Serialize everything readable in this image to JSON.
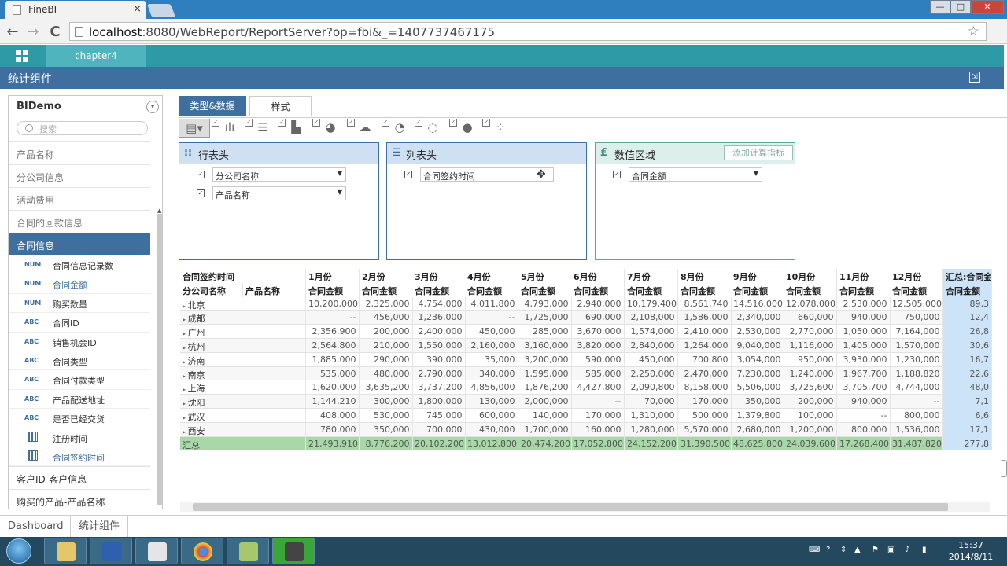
{
  "browser": {
    "tab_title": "FineBI",
    "tab_close": "×",
    "url_host": "localhost",
    "url_rest": ":8080/WebReport/ReportServer?op=fbi&_=1407737467175",
    "back": "←",
    "forward": "→",
    "reload": "C",
    "star": "☆",
    "menu": "≡",
    "win_min": "—",
    "win_max": "□",
    "win_close": "✕"
  },
  "app": {
    "chapter_tab": "chapter4",
    "header_title": "统计组件"
  },
  "left_panel": {
    "package_name": "BIDemo",
    "search_placeholder": "搜索",
    "groups_top": [
      "产品名称",
      "分公司信息",
      "活动费用",
      "合同的回款信息"
    ],
    "selected_group": "合同信息",
    "fields": [
      {
        "type": "NUM",
        "label": "合同信息记录数",
        "selected": false
      },
      {
        "type": "NUM",
        "label": "合同金额",
        "selected": true
      },
      {
        "type": "NUM",
        "label": "购买数量",
        "selected": false
      },
      {
        "type": "ABC",
        "label": "合同ID",
        "selected": false
      },
      {
        "type": "ABC",
        "label": "销售机会ID",
        "selected": false
      },
      {
        "type": "ABC",
        "label": "合同类型",
        "selected": false
      },
      {
        "type": "ABC",
        "label": "合同付款类型",
        "selected": false
      },
      {
        "type": "ABC",
        "label": "产品配送地址",
        "selected": false
      },
      {
        "type": "ABC",
        "label": "是否已经交货",
        "selected": false
      },
      {
        "type": "DATE",
        "label": "注册时间",
        "selected": false
      },
      {
        "type": "DATE",
        "label": "合同签约时间",
        "selected": true
      }
    ],
    "groups_bottom": [
      "客户ID-客户信息",
      "购买的产品-产品名称"
    ]
  },
  "tabs": {
    "type_data": "类型&数据",
    "style": "样式"
  },
  "regions": {
    "row_header": {
      "title": "行表头",
      "items": [
        "分公司名称",
        "产品名称"
      ]
    },
    "column_header": {
      "title": "列表头",
      "items": [
        "合同签约时间"
      ]
    },
    "value_area": {
      "title": "数值区域",
      "add_button": "添加计算指标",
      "items": [
        "合同金额"
      ]
    }
  },
  "table": {
    "corner_top": "合同签约时间",
    "corner_left1": "分公司名称",
    "corner_left2": "产品名称",
    "months": [
      "1月份",
      "2月份",
      "3月份",
      "4月份",
      "5月份",
      "6月份",
      "7月份",
      "8月份",
      "9月份",
      "10月份",
      "11月份",
      "12月份"
    ],
    "total_header": "汇总:合同金",
    "measure": "合同金额",
    "rows": [
      {
        "city": "北京",
        "values": [
          "10,200,000",
          "2,325,000",
          "4,754,000",
          "4,011,800",
          "4,793,000",
          "2,940,000",
          "10,179,400",
          "8,561,740",
          "14,516,000",
          "12,078,000",
          "2,530,000",
          "12,505,000"
        ],
        "total": "89,3"
      },
      {
        "city": "成都",
        "values": [
          "--",
          "456,000",
          "1,236,000",
          "--",
          "1,725,000",
          "690,000",
          "2,108,000",
          "1,586,000",
          "2,340,000",
          "660,000",
          "940,000",
          "750,000"
        ],
        "total": "12,4"
      },
      {
        "city": "广州",
        "values": [
          "2,356,900",
          "200,000",
          "2,400,000",
          "450,000",
          "285,000",
          "3,670,000",
          "1,574,000",
          "2,410,000",
          "2,530,000",
          "2,770,000",
          "1,050,000",
          "7,164,000"
        ],
        "total": "26,8"
      },
      {
        "city": "杭州",
        "values": [
          "2,564,800",
          "210,000",
          "1,550,000",
          "2,160,000",
          "3,160,000",
          "3,820,000",
          "2,840,000",
          "1,264,000",
          "9,040,000",
          "1,116,000",
          "1,405,000",
          "1,570,000"
        ],
        "total": "30,6"
      },
      {
        "city": "济南",
        "values": [
          "1,885,000",
          "290,000",
          "390,000",
          "35,000",
          "3,200,000",
          "590,000",
          "450,000",
          "700,800",
          "3,054,000",
          "950,000",
          "3,930,000",
          "1,230,000"
        ],
        "total": "16,7"
      },
      {
        "city": "南京",
        "values": [
          "535,000",
          "480,000",
          "2,790,000",
          "340,000",
          "1,595,000",
          "585,000",
          "2,250,000",
          "2,470,000",
          "7,230,000",
          "1,240,000",
          "1,967,700",
          "1,188,820"
        ],
        "total": "22,6"
      },
      {
        "city": "上海",
        "values": [
          "1,620,000",
          "3,635,200",
          "3,737,200",
          "4,856,000",
          "1,876,200",
          "4,427,800",
          "2,090,800",
          "8,158,000",
          "5,506,000",
          "3,725,600",
          "3,705,700",
          "4,744,000"
        ],
        "total": "48,0"
      },
      {
        "city": "沈阳",
        "values": [
          "1,144,210",
          "300,000",
          "1,800,000",
          "130,000",
          "2,000,000",
          "--",
          "70,000",
          "170,000",
          "350,000",
          "200,000",
          "940,000",
          "--"
        ],
        "total": "7,1"
      },
      {
        "city": "武汉",
        "values": [
          "408,000",
          "530,000",
          "745,000",
          "600,000",
          "140,000",
          "170,000",
          "1,310,000",
          "500,000",
          "1,379,800",
          "100,000",
          "--",
          "800,000"
        ],
        "total": "6,6"
      },
      {
        "city": "西安",
        "values": [
          "780,000",
          "350,000",
          "700,000",
          "430,000",
          "1,700,000",
          "160,000",
          "1,280,000",
          "5,570,000",
          "2,680,000",
          "1,200,000",
          "800,000",
          "1,536,000"
        ],
        "total": "17,1"
      }
    ],
    "total_row": {
      "label": "汇总",
      "values": [
        "21,493,910",
        "8,776,200",
        "20,102,200",
        "13,012,800",
        "20,474,200",
        "17,052,800",
        "24,152,200",
        "31,390,500",
        "48,625,800",
        "24,039,600",
        "17,268,400",
        "31,487,820"
      ],
      "total": "277,8"
    }
  },
  "bottom_tabs": [
    "Dashboard",
    "统计组件"
  ],
  "taskbar": {
    "time": "15:37",
    "date": "2014/8/11"
  },
  "colors": {
    "accent": "#3f6f9e",
    "teal": "#2e9aa6",
    "total_row": "#a8d7a8",
    "total_col": "#cde3f7"
  }
}
